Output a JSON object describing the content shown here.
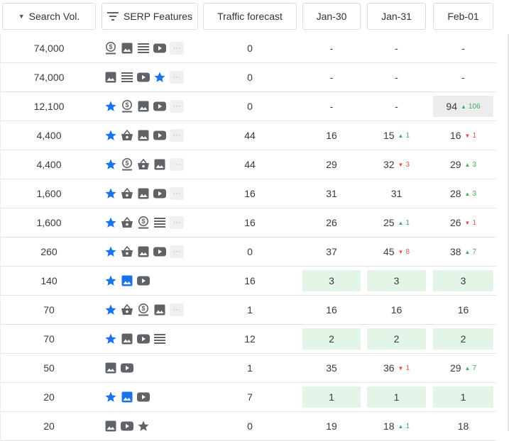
{
  "header": {
    "columns": [
      {
        "label": "Search Vol.",
        "sort": "desc"
      },
      {
        "label": "SERP Features"
      },
      {
        "label": "Traffic forecast"
      },
      {
        "label": "Jan-30"
      },
      {
        "label": "Jan-31"
      },
      {
        "label": "Feb-01"
      }
    ]
  },
  "colors": {
    "icon": "#5f6368",
    "icon_blue": "#1a73e8",
    "highlight_green": "#e3f5e6",
    "highlight_grey": "#ececec",
    "up": "#3fae62",
    "down": "#e05252"
  },
  "rows": [
    {
      "volume": "74,000",
      "features": [
        "dollar-icon",
        "image-icon",
        "list-icon",
        "video-icon",
        "more-icon"
      ],
      "traffic": "0",
      "days": [
        {
          "v": "-"
        },
        {
          "v": "-"
        },
        {
          "v": "-"
        }
      ]
    },
    {
      "volume": "74,000",
      "features": [
        "image-icon",
        "list-icon",
        "video-icon",
        "star-icon",
        "more-icon"
      ],
      "traffic": "0",
      "days": [
        {
          "v": "-"
        },
        {
          "v": "-"
        },
        {
          "v": "-"
        }
      ]
    },
    {
      "volume": "12,100",
      "features": [
        "star-icon",
        "dollar-icon",
        "image-icon",
        "video-icon",
        "more-icon"
      ],
      "traffic": "0",
      "days": [
        {
          "v": "-"
        },
        {
          "v": "-"
        },
        {
          "v": "94",
          "chg": "106",
          "dir": "up",
          "hl": "grey"
        }
      ]
    },
    {
      "volume": "4,400",
      "features": [
        "star-icon",
        "basket-icon",
        "image-icon",
        "video-icon",
        "more-icon"
      ],
      "traffic": "44",
      "days": [
        {
          "v": "16"
        },
        {
          "v": "15",
          "chg": "1",
          "dir": "up"
        },
        {
          "v": "16",
          "chg": "1",
          "dir": "down"
        }
      ]
    },
    {
      "volume": "4,400",
      "features": [
        "star-icon",
        "dollar-icon",
        "basket-icon",
        "image-icon",
        "more-icon"
      ],
      "traffic": "44",
      "days": [
        {
          "v": "29"
        },
        {
          "v": "32",
          "chg": "3",
          "dir": "down"
        },
        {
          "v": "29",
          "chg": "3",
          "dir": "up"
        }
      ]
    },
    {
      "volume": "1,600",
      "features": [
        "star-icon",
        "basket-icon",
        "image-icon",
        "video-icon",
        "more-icon"
      ],
      "traffic": "16",
      "days": [
        {
          "v": "31"
        },
        {
          "v": "31"
        },
        {
          "v": "28",
          "chg": "3",
          "dir": "up"
        }
      ]
    },
    {
      "volume": "1,600",
      "features": [
        "star-icon",
        "basket-icon",
        "dollar-icon",
        "list-icon",
        "more-icon"
      ],
      "traffic": "16",
      "days": [
        {
          "v": "26"
        },
        {
          "v": "25",
          "chg": "1",
          "dir": "up"
        },
        {
          "v": "26",
          "chg": "1",
          "dir": "down"
        }
      ]
    },
    {
      "volume": "260",
      "features": [
        "star-icon",
        "basket-icon",
        "image-icon",
        "video-icon",
        "more-icon"
      ],
      "traffic": "0",
      "days": [
        {
          "v": "37"
        },
        {
          "v": "45",
          "chg": "8",
          "dir": "down"
        },
        {
          "v": "38",
          "chg": "7",
          "dir": "up"
        }
      ]
    },
    {
      "volume": "140",
      "features": [
        "star-icon",
        "image-blue-icon",
        "video-icon"
      ],
      "traffic": "16",
      "days": [
        {
          "v": "3",
          "hl": "green"
        },
        {
          "v": "3",
          "hl": "green"
        },
        {
          "v": "3",
          "hl": "green"
        }
      ]
    },
    {
      "volume": "70",
      "features": [
        "star-icon",
        "basket-icon",
        "dollar-icon",
        "image-icon",
        "more-icon"
      ],
      "traffic": "1",
      "days": [
        {
          "v": "16"
        },
        {
          "v": "16"
        },
        {
          "v": "16"
        }
      ]
    },
    {
      "volume": "70",
      "features": [
        "star-icon",
        "image-icon",
        "video-icon",
        "list-icon"
      ],
      "traffic": "12",
      "days": [
        {
          "v": "2",
          "hl": "green"
        },
        {
          "v": "2",
          "hl": "green"
        },
        {
          "v": "2",
          "hl": "green"
        }
      ]
    },
    {
      "volume": "50",
      "features": [
        "image-icon",
        "video-icon"
      ],
      "traffic": "1",
      "days": [
        {
          "v": "35"
        },
        {
          "v": "36",
          "chg": "1",
          "dir": "down"
        },
        {
          "v": "29",
          "chg": "7",
          "dir": "up"
        }
      ]
    },
    {
      "volume": "20",
      "features": [
        "star-icon",
        "image-blue-icon",
        "video-icon"
      ],
      "traffic": "7",
      "days": [
        {
          "v": "1",
          "hl": "green"
        },
        {
          "v": "1",
          "hl": "green"
        },
        {
          "v": "1",
          "hl": "green"
        }
      ]
    },
    {
      "volume": "20",
      "features": [
        "image-icon",
        "video-icon",
        "star-grey-icon"
      ],
      "traffic": "0",
      "days": [
        {
          "v": "19"
        },
        {
          "v": "18",
          "chg": "1",
          "dir": "up"
        },
        {
          "v": "18"
        }
      ]
    }
  ]
}
